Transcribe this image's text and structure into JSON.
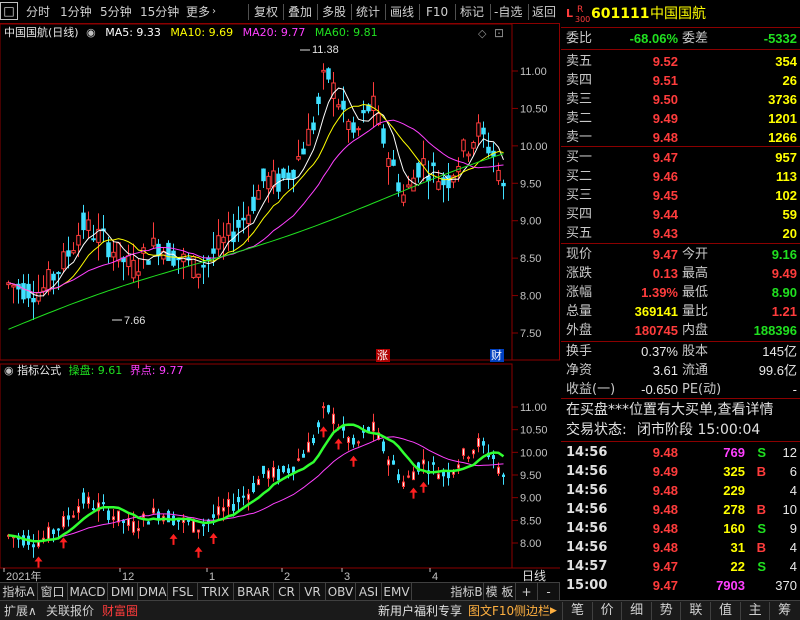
{
  "toolbar": {
    "items": [
      "分时",
      "1分钟",
      "5分钟",
      "15分钟",
      "更多",
      "复权",
      "叠加",
      "多股",
      "统计",
      "画线",
      "F10",
      "标记",
      "-自选",
      "返回"
    ],
    "more_arrow": "›"
  },
  "main": {
    "stock_title": "中国国航(日线)",
    "ma5": "MA5: 9.33",
    "ma10": "MA10: 9.69",
    "ma20": "MA20: 9.77",
    "ma60": "MA60: 9.81",
    "high_label": "11.38",
    "low_label": "7.66",
    "y_ticks": [
      "11.00",
      "10.50",
      "10.00",
      "9.50",
      "9.00",
      "8.50",
      "8.00",
      "7.50"
    ],
    "badge_up": "涨",
    "badge_fin": "财"
  },
  "indicator": {
    "title": "指标公式",
    "caopan": "操盘: 9.61",
    "jiedian": "界点: 9.77",
    "y_ticks": [
      "11.00",
      "10.50",
      "10.00",
      "9.50",
      "9.00",
      "8.50",
      "8.00"
    ]
  },
  "xaxis": {
    "labels": [
      "2021年",
      "12",
      "1",
      "2",
      "3",
      "4"
    ],
    "right_label": "日线"
  },
  "colors": {
    "up": "#ff3c3c",
    "down": "#40e0ff",
    "ma5": "#ffffff",
    "ma10": "#ffff00",
    "ma20": "#ff40ff",
    "ma60": "#20e020",
    "border": "#8b0000"
  },
  "quote": {
    "market_icon": "L R 300",
    "code": "601111",
    "name": "中国国航",
    "weibi_label": "委比",
    "weibi": "-68.06%",
    "weicha_label": "委差",
    "weicha": "-5332",
    "asks": [
      {
        "label": "卖五",
        "price": "9.52",
        "vol": "354"
      },
      {
        "label": "卖四",
        "price": "9.51",
        "vol": "26"
      },
      {
        "label": "卖三",
        "price": "9.50",
        "vol": "3736"
      },
      {
        "label": "卖二",
        "price": "9.49",
        "vol": "1201"
      },
      {
        "label": "卖一",
        "price": "9.48",
        "vol": "1266"
      }
    ],
    "bids": [
      {
        "label": "买一",
        "price": "9.47",
        "vol": "957"
      },
      {
        "label": "买二",
        "price": "9.46",
        "vol": "113"
      },
      {
        "label": "买三",
        "price": "9.45",
        "vol": "102"
      },
      {
        "label": "买四",
        "price": "9.44",
        "vol": "59"
      },
      {
        "label": "买五",
        "price": "9.43",
        "vol": "20"
      }
    ],
    "stats": [
      {
        "l1": "现价",
        "v1": "9.47",
        "c1": "red",
        "l2": "今开",
        "v2": "9.16",
        "c2": "green"
      },
      {
        "l1": "涨跌",
        "v1": "0.13",
        "c1": "red",
        "l2": "最高",
        "v2": "9.49",
        "c2": "red"
      },
      {
        "l1": "涨幅",
        "v1": "1.39%",
        "c1": "red",
        "l2": "最低",
        "v2": "8.90",
        "c2": "green"
      },
      {
        "l1": "总量",
        "v1": "369141",
        "c1": "yellow",
        "l2": "量比",
        "v2": "1.21",
        "c2": "red"
      },
      {
        "l1": "外盘",
        "v1": "180745",
        "c1": "red",
        "l2": "内盘",
        "v2": "188396",
        "c2": "green"
      }
    ],
    "stats2": [
      {
        "l1": "换手",
        "v1": "0.37%",
        "l2": "股本",
        "v2": "145亿"
      },
      {
        "l1": "净资",
        "v1": "3.61",
        "l2": "流通",
        "v2": "99.6亿"
      },
      {
        "l1": "收益(一)",
        "v1": "-0.650",
        "l2": "PE(动)",
        "v2": "-"
      }
    ],
    "news": "在买盘***位置有大买单,查看详情",
    "status_label": "交易状态:",
    "status": "闭市阶段 15:00:04",
    "ticks": [
      {
        "time": "14:56",
        "price": "9.48",
        "vol": "769",
        "bs": "S",
        "n": "12",
        "vc": "magenta",
        "bc": "green"
      },
      {
        "time": "14:56",
        "price": "9.49",
        "vol": "325",
        "bs": "B",
        "n": "6",
        "vc": "yellow",
        "bc": "red"
      },
      {
        "time": "14:56",
        "price": "9.48",
        "vol": "229",
        "bs": "",
        "n": "4",
        "vc": "yellow",
        "bc": "green"
      },
      {
        "time": "14:56",
        "price": "9.48",
        "vol": "278",
        "bs": "B",
        "n": "10",
        "vc": "yellow",
        "bc": "red"
      },
      {
        "time": "14:56",
        "price": "9.48",
        "vol": "160",
        "bs": "S",
        "n": "9",
        "vc": "yellow",
        "bc": "green"
      },
      {
        "time": "14:56",
        "price": "9.48",
        "vol": "31",
        "bs": "B",
        "n": "4",
        "vc": "yellow",
        "bc": "red"
      },
      {
        "time": "14:57",
        "price": "9.47",
        "vol": "22",
        "bs": "S",
        "n": "4",
        "vc": "yellow",
        "bc": "green"
      },
      {
        "time": "15:00",
        "price": "9.47",
        "vol": "7903",
        "bs": "",
        "n": "370",
        "vc": "magenta",
        "bc": "green"
      }
    ]
  },
  "indicator_bar": {
    "items": [
      "指标A",
      "窗口",
      "MACD",
      "DMI",
      "DMA",
      "FSL",
      "TRIX",
      "BRAR",
      "CR",
      "VR",
      "OBV",
      "ASI",
      "EMV",
      "",
      "指标B",
      "模 板",
      "+",
      "-"
    ]
  },
  "status_bar": {
    "left": [
      "扩展∧",
      "关联报价",
      "财富圈"
    ],
    "promo": "新用户福利专享",
    "f10": "图文F10",
    "side": "侧边栏",
    "right_tabs": [
      "笔",
      "价",
      "细",
      "势",
      "联",
      "值",
      "主",
      "筹"
    ]
  }
}
